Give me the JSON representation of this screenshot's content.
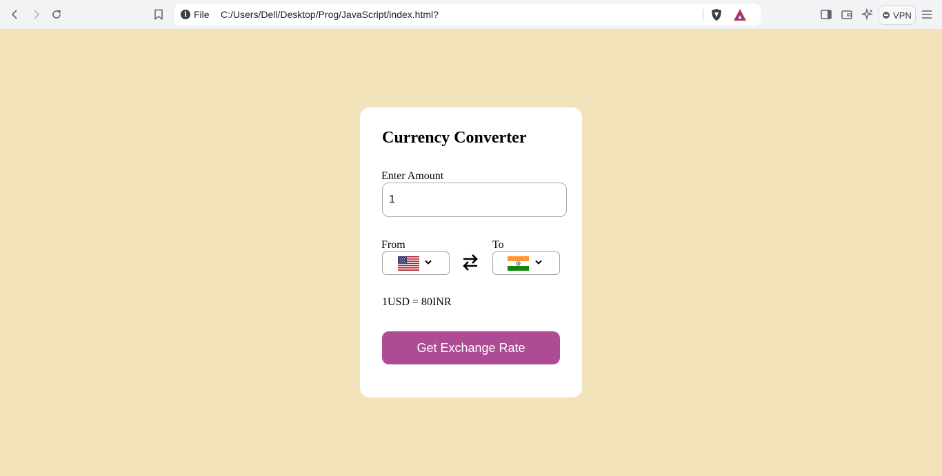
{
  "browser": {
    "url_scheme": "File",
    "url": "C:/Users/Dell/Desktop/Prog/JavaScript/index.html?",
    "vpn_label": "VPN"
  },
  "converter": {
    "title": "Currency Converter",
    "amount_label": "Enter Amount",
    "amount_value": "1",
    "from_label": "From",
    "to_label": "To",
    "from_currency_flag": "us-flag-icon",
    "to_currency_flag": "india-flag-icon",
    "rate_message": "1USD = 80INR",
    "button_label": "Get Exchange Rate"
  },
  "colors": {
    "page_background": "#f2e3ba",
    "card_background": "#ffffff",
    "button_background": "#ad4c95"
  }
}
